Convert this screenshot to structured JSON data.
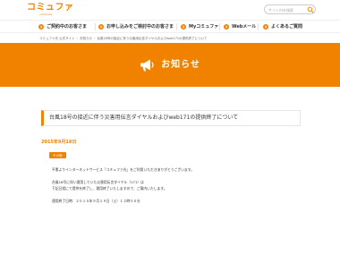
{
  "header": {
    "logo_main": "コミュファ",
    "logo_sub": "commufa",
    "search_placeholder": "サイト内を検索",
    "accent_color": "#f08200"
  },
  "nav": {
    "items": [
      {
        "label": "ご契約中のお客さま",
        "icon": "arrow-right-icon"
      },
      {
        "label": "お申し込みをご検討中のお客さま",
        "icon": "arrow-right-icon"
      },
      {
        "label": "Myコミュファ",
        "icon": "arrow-right-icon"
      },
      {
        "label": "Webメール",
        "icon": "arrow-right-icon"
      },
      {
        "label": "よくあるご質問",
        "icon": "arrow-right-icon"
      }
    ]
  },
  "breadcrumb": {
    "items": [
      "コミュファ光 公式サイト",
      "お知らせ",
      "台風18号の接近に伴う災害用伝言ダイヤルおよびweb171の提供終了について"
    ]
  },
  "banner": {
    "title": "お知らせ",
    "icon": "megaphone-icon",
    "color": "#f08200"
  },
  "article": {
    "title": "台風18号の接近に伴う災害用伝言ダイヤルおよびweb171の提供終了について",
    "date": "2015年9月18日",
    "category": "その他",
    "paragraphs": [
      "平素よりインターネットサービス「コミュファ光」をご利用いただきありがとうございます。",
      "台風18号に伴い運用していた災害用伝言ダイヤル（171）は",
      "下記日程にて提供を終了し、運用終了いたしますので、ご案内いたします。",
      "運用終了日時：２０１５年９月１９日（土）１２時００分"
    ]
  }
}
